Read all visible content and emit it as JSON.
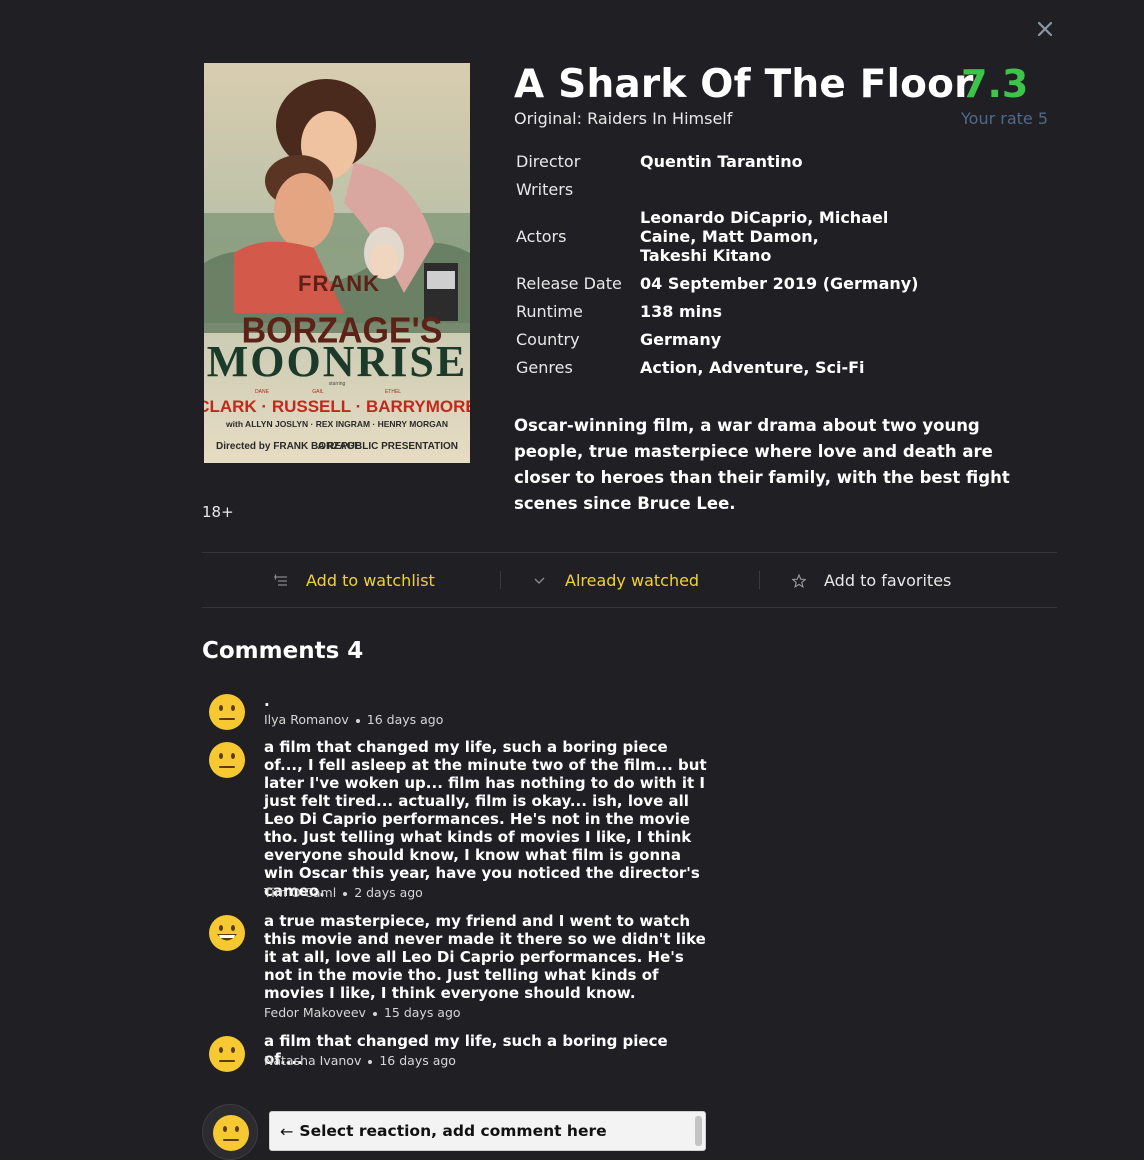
{
  "movie": {
    "title": "A Shark Of The Floor",
    "original": "Original: Raiders In Himself",
    "rating": "7.3",
    "your_rate": "Your rate 5",
    "age_rating": "18+",
    "poster": {
      "top_name": "FRANK",
      "studio_name": "BORZAGE'S",
      "film_title": "MOONRISE",
      "starring": "starring",
      "star_first_names": [
        "DANE",
        "GAIL",
        "ETHEL"
      ],
      "star_last_names": "CLARK · RUSSELL · BARRYMORE",
      "supporting": "with ALLYN JOSLYN · REX INGRAM · HENRY MORGAN",
      "directed_by": "Directed by FRANK BORZAGE",
      "presentation": "A REPUBLIC PRESENTATION"
    },
    "details": {
      "director_label": "Director",
      "director": "Quentin Tarantino",
      "writers_label": "Writers",
      "writers": "",
      "actors_label": "Actors",
      "actors": "Leonardo DiCaprio, Michael Caine, Matt Damon, Takeshi Kitano",
      "release_label": "Release Date",
      "release": "04 September 2019 (Germany)",
      "runtime_label": "Runtime",
      "runtime": "138 mins",
      "country_label": "Country",
      "country": "Germany",
      "genres_label": "Genres",
      "genres": "Action, Adventure, Sci-Fi"
    },
    "description": "Oscar-winning film, a war drama about two young people, true masterpiece where love and death are closer to heroes than their family, with the best fight scenes since Bruce Lee."
  },
  "actions": {
    "watchlist": {
      "label": "Add to watchlist",
      "icon": "list-add-icon"
    },
    "watched": {
      "label": "Already watched",
      "icon": "checkmark-icon"
    },
    "favorites": {
      "label": "Add to favorites",
      "icon": "star-outline-icon"
    }
  },
  "comments": {
    "title": "Comments 4",
    "items": [
      {
        "text": ".",
        "author": "Ilya Romanov",
        "time": "16 days ago",
        "reaction": "neutral-face-icon"
      },
      {
        "text": "a film that changed my life, such a boring piece of..., I fell asleep at the minute two of the film... but later I've woken up... film has nothing to do with it I just felt tired... actually, film is okay... ish, love all Leo Di Caprio performances. He's not in the movie tho. Just telling what kinds of movies I like, I think everyone should know, I know what film is gonna win Oscar this year, have you noticed the director's cameo.",
        "author": "Tim O'Caml",
        "time": "2 days ago",
        "reaction": "neutral-face-icon"
      },
      {
        "text": "a true masterpiece, my friend and I went to watch this movie and never made it there so we didn't like it at all, love all Leo Di Caprio performances. He's not in the movie tho. Just telling what kinds of movies I like, I think everyone should know.",
        "author": "Fedor Makoveev",
        "time": "15 days ago",
        "reaction": "grinning-face-icon"
      },
      {
        "text": "a film that changed my life, such a boring piece of....",
        "author": "Natasha Ivanov",
        "time": "16 days ago",
        "reaction": "neutral-face-icon"
      }
    ],
    "composer": {
      "arrow": "←",
      "placeholder": "Select reaction, add comment here",
      "reaction": "neutral-face-icon"
    }
  },
  "colors": {
    "background": "#202024",
    "rating_green": "#3ec44b",
    "your_rate_blue": "#4d6a8c",
    "accent_yellow": "#f2d32e",
    "emoji_yellow": "#f6c832"
  }
}
